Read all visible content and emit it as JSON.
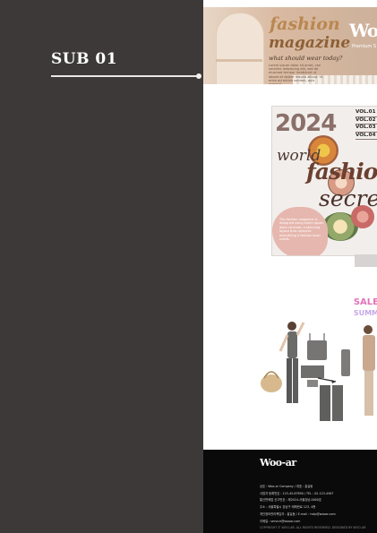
{
  "side": {
    "title": "SUB 01"
  },
  "hero": {
    "title_line1": "fashion",
    "title_line2": "magazine",
    "question": "what should wear today?",
    "body": "Lorem ipsum dolor sit amet, con sectetur adipiscing elit, sed do eiusmod tempor incididunt ut labore et dolore magna aliqua. Ut enim ad minim veniam, quis nostrud.",
    "brand": "Woo",
    "brand_sub": "Premium S"
  },
  "poster": {
    "year": "2024",
    "vols": [
      "VOL.01 S",
      "VOL.02 S",
      "VOL.03 S",
      "VOL.04 S"
    ],
    "word_world": "world",
    "word_fashion": "fashion",
    "word_secret": "secret",
    "body": "The fashion magazine is designed using lorem ipsum dolor sit amet, a stunning layout that captures everything a fashion lover needs."
  },
  "outfit": {
    "promo_line1": "SALE",
    "promo_line2": "SUMM"
  },
  "footer": {
    "logo": "Woo-ar",
    "lines": [
      "상호 : Woo-ar Company  /  대표 : 홍길동",
      "사업자 등록번호 : 123-45-67890  /  TEL : 02-123-4567",
      "통신판매업 신고번호 : 제2024-서울강남-0000호",
      "주소 : 서울특별시 강남구 테헤란로 123, 4층",
      "개인정보관리책임자 : 홍길동  /  E-mail : help@wooar.com",
      "이메일 : service@wooar.com",
      "COPYRIGHT © WOO-AR. ALL RIGHTS RESERVED. DESIGNED BY WOO-AR"
    ]
  },
  "colors": {
    "sidebar": "#3d3938",
    "footer": "#0a0a0a",
    "accent_gold": "#b9874f"
  }
}
